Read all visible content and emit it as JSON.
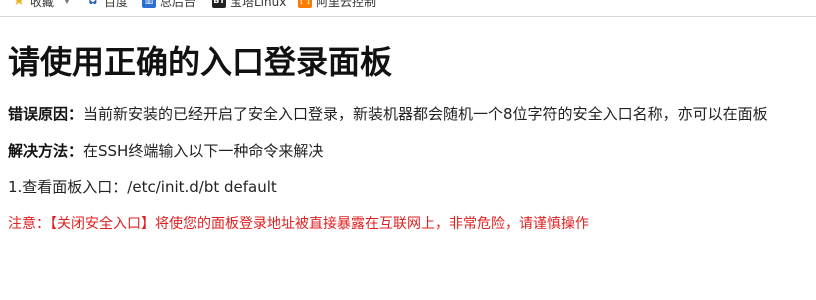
{
  "bookmarks": {
    "favorites_label": "收藏",
    "baidu_label": "百度",
    "admin_label": "总后台",
    "bt_label": "宝塔Linux",
    "aliyun_label": "阿里云控制"
  },
  "page": {
    "title": "请使用正确的入口登录面板",
    "error_reason_label": "错误原因：",
    "error_reason_text": "当前新安装的已经开启了安全入口登录，新装机器都会随机一个8位字符的安全入口名称，亦可以在面板",
    "solution_label": "解决方法：",
    "solution_text": "在SSH终端输入以下一种命令来解决",
    "step1_text": "1.查看面板入口：/etc/init.d/bt default",
    "warning_text": "注意：【关闭安全入口】将使您的面板登录地址被直接暴露在互联网上，非常危险，请谨慎操作"
  },
  "colors": {
    "warning": "#e02020",
    "favorites_star": "#f2b01e"
  }
}
